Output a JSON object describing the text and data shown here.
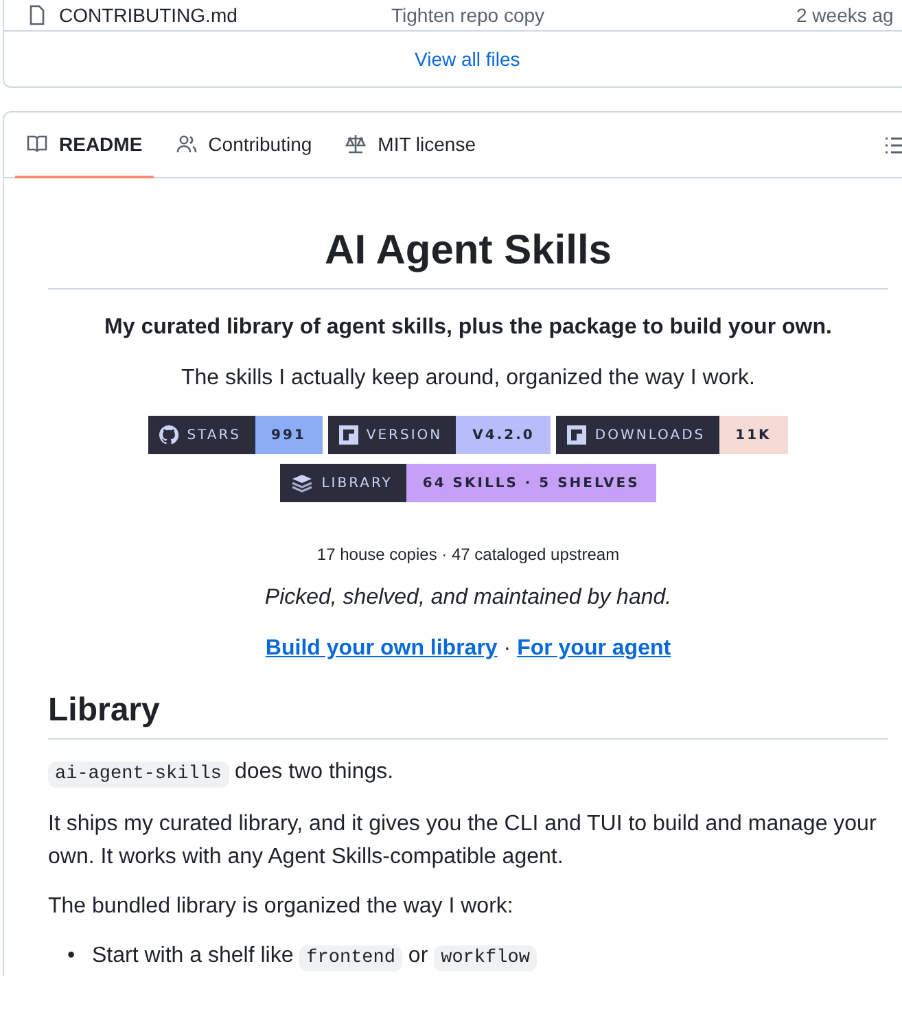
{
  "files": {
    "rows": [
      {
        "name": "CONTRIBUTING.md",
        "message": "Tighten repo copy",
        "age": "2 weeks ag"
      }
    ],
    "view_all": "View all files"
  },
  "readme": {
    "tabs": [
      {
        "label": "README",
        "selected": true
      },
      {
        "label": "Contributing",
        "selected": false
      },
      {
        "label": "MIT license",
        "selected": false
      }
    ],
    "title": "AI Agent Skills",
    "tagline": "My curated library of agent skills, plus the package to build your own.",
    "intro": "The skills I actually keep around, organized the way I work.",
    "badge_rows": [
      [
        {
          "kind": "github",
          "label": "STARS",
          "value": "991",
          "color": "#8aadf4"
        },
        {
          "kind": "npm",
          "label": "VERSION",
          "value": "V4.2.0",
          "color": "#b7bdf8"
        },
        {
          "kind": "npm",
          "label": "DOWNLOADS",
          "value": "11K",
          "color": "#f4dbd6"
        }
      ],
      [
        {
          "kind": "stack",
          "label": "LIBRARY",
          "value": "64 SKILLS · 5 SHELVES",
          "color": "#c6a0f6"
        }
      ]
    ],
    "counts": "17 house copies · 47 cataloged upstream",
    "motto": "Picked, shelved, and maintained by hand.",
    "links": [
      "Build your own library",
      "For your agent"
    ],
    "separator": "·",
    "section_heading": "Library",
    "blocks": [
      {
        "kind": "paragraph",
        "parts": [
          {
            "kind": "code",
            "text": "ai-agent-skills"
          },
          {
            "kind": "text",
            "text": " does two things."
          }
        ]
      },
      {
        "kind": "paragraph",
        "parts": [
          {
            "kind": "text",
            "text": "It ships my curated library, and it gives you the CLI and TUI to build and manage your own. It works with any Agent Skills-compatible agent."
          }
        ]
      },
      {
        "kind": "paragraph",
        "parts": [
          {
            "kind": "text",
            "text": "The bundled library is organized the way I work:"
          }
        ]
      },
      {
        "kind": "bullet",
        "marker": "•",
        "parts": [
          {
            "kind": "text",
            "text": "Start with a shelf like "
          },
          {
            "kind": "code",
            "text": "frontend"
          },
          {
            "kind": "text",
            "text": " or "
          },
          {
            "kind": "code",
            "text": "workflow"
          }
        ]
      }
    ]
  }
}
